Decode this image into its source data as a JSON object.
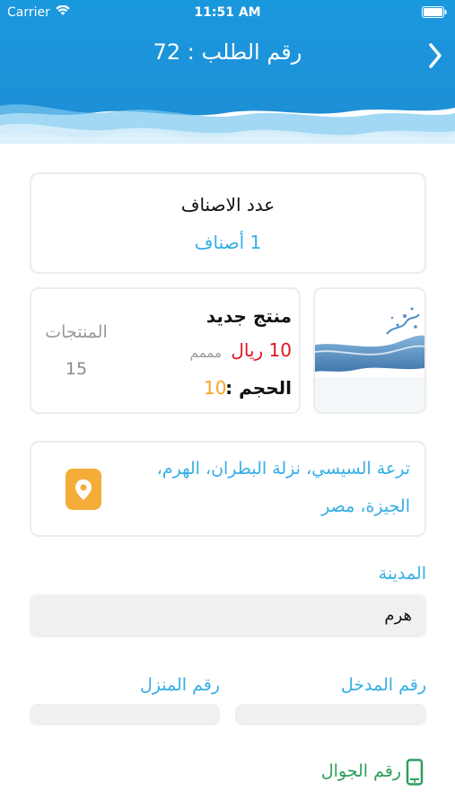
{
  "status": {
    "carrier": "Carrier",
    "time": "11:51 AM"
  },
  "header": {
    "title": "رقم الطلب : 72"
  },
  "categories": {
    "label": "عدد الاصناف",
    "value": "1 أصناف"
  },
  "product": {
    "name": "منتج جديد",
    "price": "10 ريال",
    "note": "مممم",
    "size_label": "الحجم :",
    "size_value": "10",
    "count_label": "المنتجات",
    "count_value": "15"
  },
  "address": {
    "line1": "ترعة السيسي، نزلة البطران، الهرم،",
    "line2": "الجيزة، مصر"
  },
  "city": {
    "label": "المدينة",
    "value": "هرم"
  },
  "entrance": {
    "label": "رقم المدخل",
    "value": ""
  },
  "house": {
    "label": "رقم المنزل",
    "value": ""
  },
  "mobile": {
    "label": "رقم الجوال"
  },
  "colors": {
    "primary": "#1b9be0",
    "accent_blue": "#35aee6",
    "price_red": "#e0141e",
    "size_orange": "#f5a623",
    "pin_orange": "#f5ad3a",
    "mobile_green": "#2e9e5b"
  }
}
